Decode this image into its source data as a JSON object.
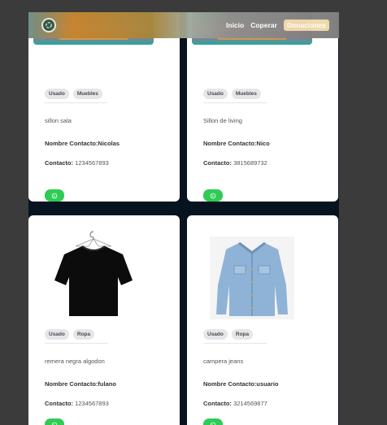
{
  "navbar": {
    "links": [
      "Inicio",
      "Coperar",
      "Donaciones"
    ]
  },
  "cards": [
    {
      "tags": [
        "Usado",
        "Muebles"
      ],
      "description": "sillon sala",
      "contact_name": "Nombre Contacto:Nicolas",
      "contact_label": "Contacto:",
      "contact_phone": "1234567893"
    },
    {
      "tags": [
        "Usado",
        "Muebles"
      ],
      "description": "Sillon de living",
      "contact_name": "Nombre Contacto:Nico",
      "contact_label": "Contacto:",
      "contact_phone": "3815689732"
    },
    {
      "tags": [
        "Usado",
        "Ropa"
      ],
      "description": "remera negra algodon",
      "contact_name": "Nombre Contacto:fulano",
      "contact_label": "Contacto:",
      "contact_phone": "1234567893"
    },
    {
      "tags": [
        "Usado",
        "Ropa"
      ],
      "description": "campera jeans",
      "contact_name": "Nombre Contacto:usuario",
      "contact_label": "Contacto:",
      "contact_phone": "3214569877"
    }
  ],
  "colors": {
    "whatsapp": "#2ecc54",
    "page_bg": "#07141f",
    "outer_bg": "#3b3b3b"
  },
  "icons": {
    "logo": "recycle-logo-icon",
    "contact_button": "whatsapp-icon"
  }
}
